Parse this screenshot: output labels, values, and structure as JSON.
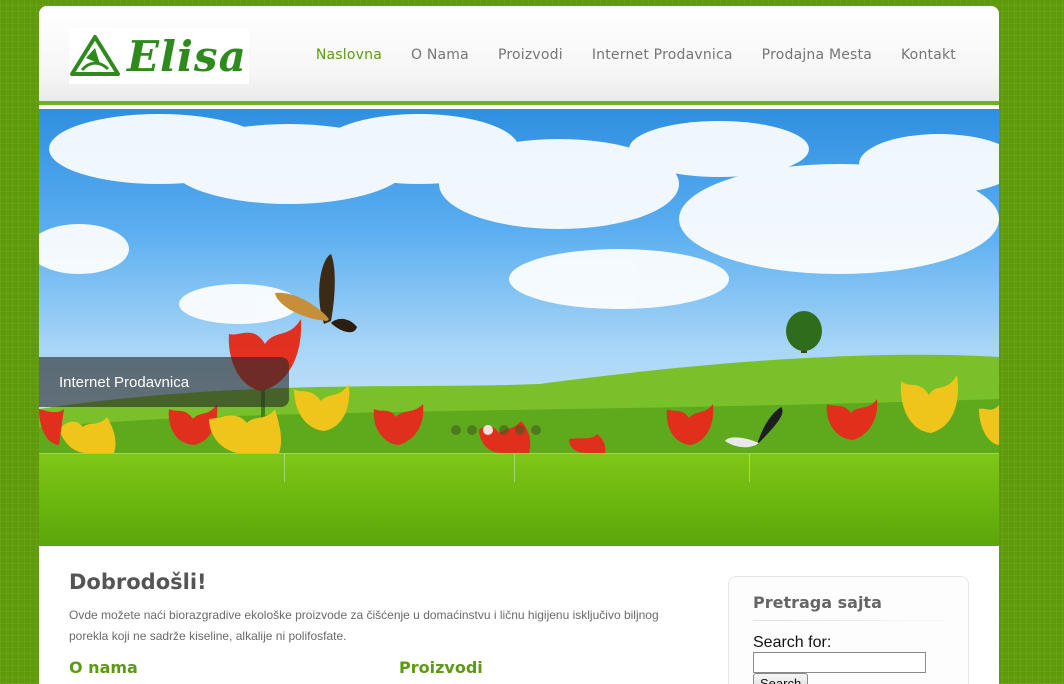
{
  "header": {
    "logo_text": "Elisa",
    "nav": [
      {
        "label": "Naslovna",
        "active": true
      },
      {
        "label": "O Nama",
        "active": false
      },
      {
        "label": "Proizvodi",
        "active": false
      },
      {
        "label": "Internet Prodavnica",
        "active": false
      },
      {
        "label": "Prodajna Mesta",
        "active": false
      },
      {
        "label": "Kontakt",
        "active": false
      }
    ]
  },
  "slider": {
    "caption": "Internet Prodavnica",
    "dots_count": 6,
    "active_dot": 3
  },
  "main": {
    "title": "Dobrodošli!",
    "text": "Ovde možete naći biorazgradive ekološke proizvode za čišćenje u domaćinstvu i ličnu higijenu isključivo biljnog porekla koji ne sadrže kiseline, alkalije ni polifosfate.",
    "columns": [
      {
        "title": "O nama"
      },
      {
        "title": "Proizvodi"
      }
    ]
  },
  "sidebar": {
    "title": "Pretraga sajta",
    "search_label": "Search for:",
    "search_value": "",
    "search_button": "Search"
  },
  "colors": {
    "brand_green": "#2f8a1d",
    "accent_green": "#6fb116",
    "active_nav": "#5c9a12"
  }
}
